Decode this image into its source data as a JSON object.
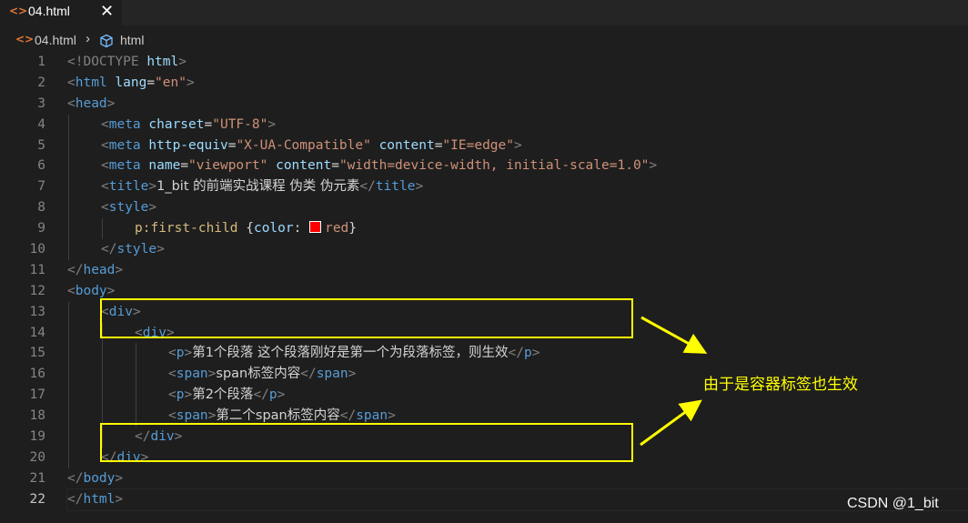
{
  "tab": {
    "label": "04.html",
    "icon": "html-file-icon",
    "close_glyph": "✕"
  },
  "breadcrumb": {
    "file": "04.html",
    "separator": "›",
    "symbol": "html"
  },
  "editor": {
    "active_line": 22,
    "line_numbers": [
      "1",
      "2",
      "3",
      "4",
      "5",
      "6",
      "7",
      "8",
      "9",
      "10",
      "11",
      "12",
      "13",
      "14",
      "15",
      "16",
      "17",
      "18",
      "19",
      "20",
      "21",
      "22"
    ],
    "code": {
      "l1": [
        "<!DOCTYPE",
        " ",
        "html",
        ">"
      ],
      "l2": [
        "<",
        "html",
        " ",
        "lang",
        "=",
        "\"en\"",
        ">"
      ],
      "l3": [
        "<",
        "head",
        ">"
      ],
      "l4": [
        "<",
        "meta",
        " ",
        "charset",
        "=",
        "\"UTF-8\"",
        ">"
      ],
      "l5": [
        "<",
        "meta",
        " ",
        "http-equiv",
        "=",
        "\"X-UA-Compatible\"",
        " ",
        "content",
        "=",
        "\"IE=edge\"",
        ">"
      ],
      "l6": [
        "<",
        "meta",
        " ",
        "name",
        "=",
        "\"viewport\"",
        " ",
        "content",
        "=",
        "\"width=device-width, initial-scale=1.0\"",
        ">"
      ],
      "l7": [
        "<",
        "title",
        ">",
        "1_bit 的前端实战课程 伪类 伪元素",
        "</",
        "title",
        ">"
      ],
      "l8": [
        "<",
        "style",
        ">"
      ],
      "l9": [
        "p:first-child",
        " {",
        "color",
        ": ",
        "red",
        "}"
      ],
      "l10": [
        "</",
        "style",
        ">"
      ],
      "l11": [
        "</",
        "head",
        ">"
      ],
      "l12": [
        "<",
        "body",
        ">"
      ],
      "l13": [
        "<",
        "div",
        ">"
      ],
      "l14": [
        "<",
        "div",
        ">"
      ],
      "l15": [
        "<",
        "p",
        ">",
        "第1个段落 这个段落刚好是第一个为段落标签，则生效",
        "</",
        "p",
        ">"
      ],
      "l16": [
        "<",
        "span",
        ">",
        "span标签内容",
        "</",
        "span",
        ">"
      ],
      "l17": [
        "<",
        "p",
        ">",
        "第2个段落",
        "</",
        "p",
        ">"
      ],
      "l18": [
        "<",
        "span",
        ">",
        "第二个span标签内容",
        "</",
        "span",
        ">"
      ],
      "l19": [
        "</",
        "div",
        ">"
      ],
      "l20": [
        "</",
        "div",
        ">"
      ],
      "l21": [
        "</",
        "body",
        ">"
      ],
      "l22": [
        "</",
        "html",
        ">"
      ]
    }
  },
  "annotation": {
    "text": "由于是容器标签也生效",
    "color": "#ffff00"
  },
  "watermark": {
    "text": "CSDN @1_bit"
  },
  "colors": {
    "background": "#1e1e1e",
    "tag": "#569cd6",
    "attribute": "#9cdcfe",
    "string": "#ce9178",
    "selector": "#d7ba7d",
    "highlight": "#ffff00",
    "swatch": "#ff0000"
  }
}
